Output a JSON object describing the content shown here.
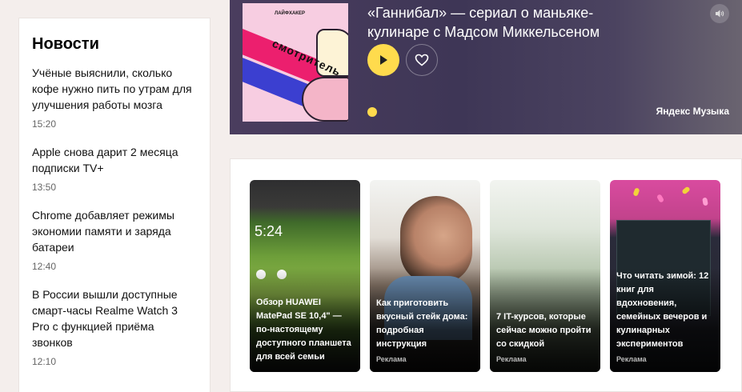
{
  "news": {
    "title": "Новости",
    "items": [
      {
        "text": "Учёные выяснили, сколько кофе нужно пить по утрам для улучшения работы мозга",
        "time": "15:20"
      },
      {
        "text": "Apple снова дарит 2 месяца подписки TV+",
        "time": "13:50"
      },
      {
        "text": "Chrome добавляет режимы экономии памяти и заряда батареи",
        "time": "12:40"
      },
      {
        "text": "В России вышли доступные смарт-часы Realme Watch 3 Pro с функцией приёма звонков",
        "time": "12:10"
      }
    ]
  },
  "player": {
    "song_title": "«Ганнибал» — сериал о маньяке-кулинаре с Мадсом Миккельсеном",
    "provider": "Яндекс Музыка",
    "cover": {
      "brand": "ЛАЙФХАКЕР",
      "label": "смотритель"
    },
    "icons": {
      "play": "play-icon",
      "like": "heart-icon",
      "volume": "volume-icon"
    },
    "colors": {
      "accent": "#ffdb4d"
    }
  },
  "cards": [
    {
      "title": "Обзор HUAWEI MatePad SE 10,4\" — по-настоящему доступного планшета для всей семьи",
      "ad": "",
      "clock": "5:24"
    },
    {
      "title": "Как приготовить вкусный стейк дома: подробная инструкция",
      "ad": "Реклама"
    },
    {
      "title": "7 IT-курсов, которые сейчас можно пройти со скидкой",
      "ad": "Реклама"
    },
    {
      "title": "Что читать зимой: 12 книг для вдохновения, семейных вечеров и кулинарных экспериментов",
      "ad": "Реклама"
    }
  ]
}
